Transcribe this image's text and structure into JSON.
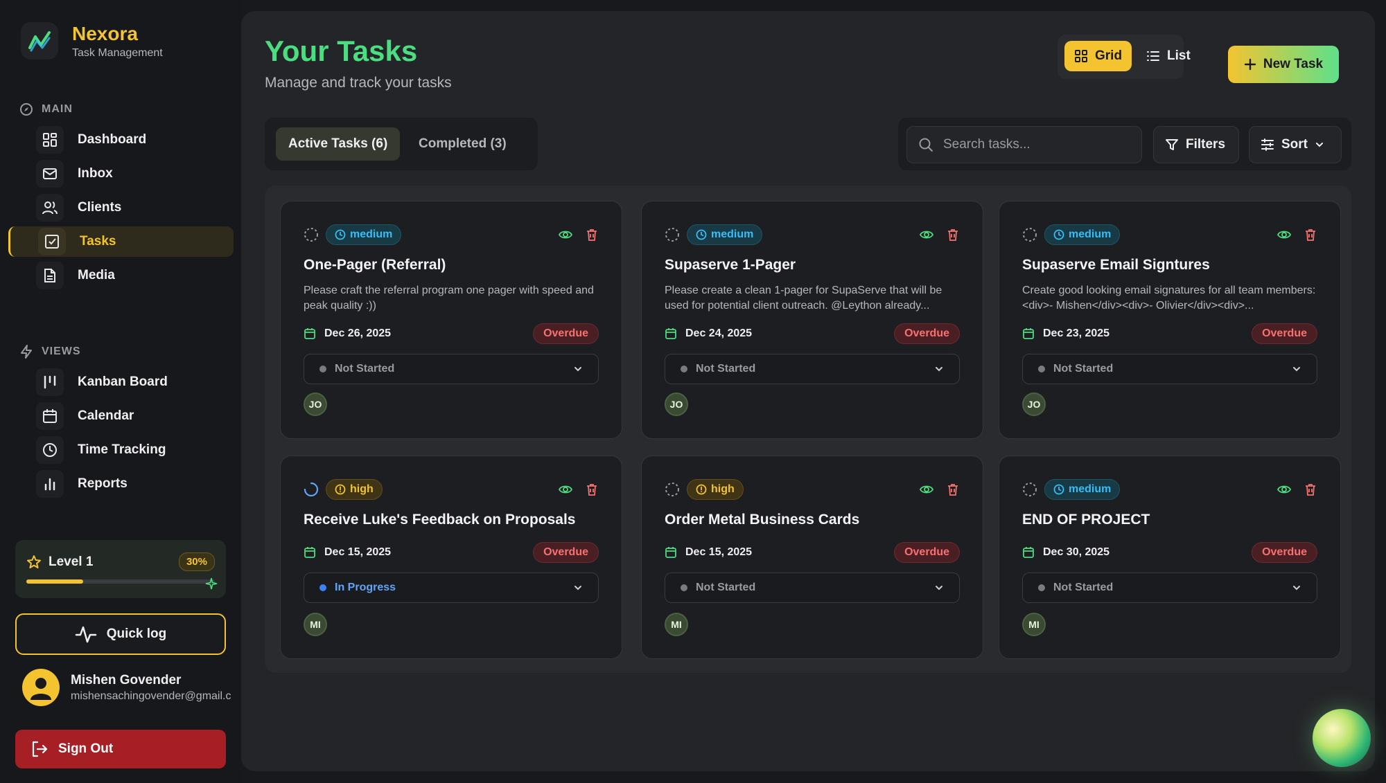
{
  "brand": {
    "name": "Nexora",
    "subtitle": "Task Management"
  },
  "sidebar": {
    "main_title": "MAIN",
    "main_items": [
      {
        "label": "Dashboard",
        "icon": "dashboard-icon"
      },
      {
        "label": "Inbox",
        "icon": "mail-icon"
      },
      {
        "label": "Clients",
        "icon": "users-icon"
      },
      {
        "label": "Tasks",
        "icon": "checkbox-icon",
        "active": true
      },
      {
        "label": "Media",
        "icon": "file-icon"
      }
    ],
    "views_title": "VIEWS",
    "view_items": [
      {
        "label": "Kanban Board",
        "icon": "kanban-icon"
      },
      {
        "label": "Calendar",
        "icon": "calendar-icon"
      },
      {
        "label": "Time Tracking",
        "icon": "clock-icon"
      },
      {
        "label": "Reports",
        "icon": "bar-chart-icon"
      }
    ],
    "level": {
      "label": "Level 1",
      "percent_label": "30%",
      "progress": 0.3
    },
    "quick_log": "Quick log",
    "user": {
      "name": "Mishen Govender",
      "email": "mishensachingovender@gmail.c"
    },
    "sign_out": "Sign Out"
  },
  "header": {
    "title": "Your Tasks",
    "subtitle": "Manage and track your tasks",
    "view_grid": "Grid",
    "view_list": "List",
    "new_task": "New Task"
  },
  "tabs": {
    "active": "Active Tasks (6)",
    "completed": "Completed (3)"
  },
  "toolbar": {
    "search_placeholder": "Search tasks...",
    "filters": "Filters",
    "sort": "Sort"
  },
  "colors": {
    "accent": "#f4c430",
    "green": "#4ade80",
    "overdue": "#f87171",
    "medium": "#38bdf8",
    "danger": "#a51f25"
  },
  "tasks": [
    {
      "priority": "medium",
      "title": "One-Pager (Referral)",
      "description": "Please craft the referral program one pager with speed and peak quality :))",
      "date": "Dec 26, 2025",
      "badge": "Overdue",
      "status": "Not Started",
      "assignee": "JO"
    },
    {
      "priority": "medium",
      "title": "Supaserve 1-Pager",
      "description": "Please create a clean 1-pager for SupaServe that will be used for potential client outreach. @Leython already...",
      "date": "Dec 24, 2025",
      "badge": "Overdue",
      "status": "Not Started",
      "assignee": "JO"
    },
    {
      "priority": "medium",
      "title": "Supaserve Email Signtures",
      "description": "Create good looking email signatures for all team members:<div>- Mishen</div><div>- Olivier</div><div>...",
      "date": "Dec 23, 2025",
      "badge": "Overdue",
      "status": "Not Started",
      "assignee": "JO"
    },
    {
      "priority": "high",
      "title": "Receive Luke's Feedback on Proposals",
      "description": "",
      "date": "Dec 15, 2025",
      "badge": "Overdue",
      "status": "In Progress",
      "assignee": "MI"
    },
    {
      "priority": "high",
      "title": "Order Metal Business Cards",
      "description": "",
      "date": "Dec 15, 2025",
      "badge": "Overdue",
      "status": "Not Started",
      "assignee": "MI"
    },
    {
      "priority": "medium",
      "title": "END OF PROJECT",
      "description": "",
      "date": "Dec 30, 2025",
      "badge": "Overdue",
      "status": "Not Started",
      "assignee": "MI"
    }
  ]
}
